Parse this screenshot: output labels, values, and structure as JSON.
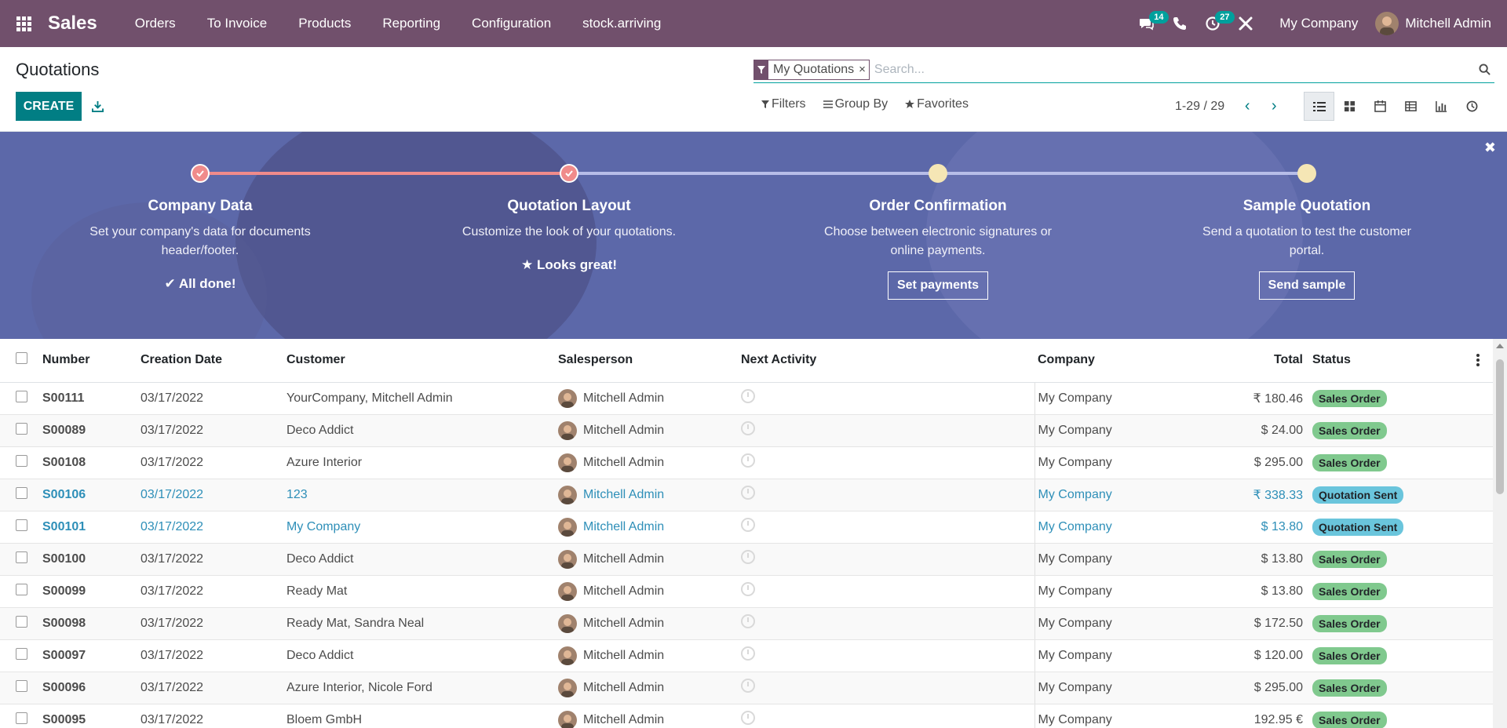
{
  "navbar": {
    "app_name": "Sales",
    "menu": [
      "Orders",
      "To Invoice",
      "Products",
      "Reporting",
      "Configuration",
      "stock.arriving"
    ],
    "messages_count": "14",
    "activities_count": "27",
    "company": "My Company",
    "user": "Mitchell Admin"
  },
  "control_panel": {
    "title": "Quotations",
    "create_label": "CREATE",
    "facet_label": "My Quotations",
    "facet_close": "×",
    "search_placeholder": "Search...",
    "filters_label": "Filters",
    "groupby_label": "Group By",
    "favorites_label": "Favorites",
    "pager": "1-29 / 29"
  },
  "banner": {
    "steps": [
      {
        "title": "Company Data",
        "desc": "Set your company's data for documents header/footer.",
        "status": "All done!"
      },
      {
        "title": "Quotation Layout",
        "desc": "Customize the look of your quotations.",
        "status": "Looks great!"
      },
      {
        "title": "Order Confirmation",
        "desc": "Choose between electronic signatures or online payments.",
        "button": "Set payments"
      },
      {
        "title": "Sample Quotation",
        "desc": "Send a quotation to test the customer portal.",
        "button": "Send sample"
      }
    ]
  },
  "table": {
    "headers": {
      "number": "Number",
      "date": "Creation Date",
      "customer": "Customer",
      "salesperson": "Salesperson",
      "activity": "Next Activity",
      "company": "Company",
      "total": "Total",
      "status": "Status"
    },
    "rows": [
      {
        "number": "S00111",
        "date": "03/17/2022",
        "customer": "YourCompany, Mitchell Admin",
        "salesperson": "Mitchell Admin",
        "company": "My Company",
        "total": "₹ 180.46",
        "status": "Sales Order"
      },
      {
        "number": "S00089",
        "date": "03/17/2022",
        "customer": "Deco Addict",
        "salesperson": "Mitchell Admin",
        "company": "My Company",
        "total": "$ 24.00",
        "status": "Sales Order"
      },
      {
        "number": "S00108",
        "date": "03/17/2022",
        "customer": "Azure Interior",
        "salesperson": "Mitchell Admin",
        "company": "My Company",
        "total": "$ 295.00",
        "status": "Sales Order"
      },
      {
        "number": "S00106",
        "date": "03/17/2022",
        "customer": "123",
        "salesperson": "Mitchell Admin",
        "company": "My Company",
        "total": "₹ 338.33",
        "status": "Quotation Sent"
      },
      {
        "number": "S00101",
        "date": "03/17/2022",
        "customer": "My Company",
        "salesperson": "Mitchell Admin",
        "company": "My Company",
        "total": "$ 13.80",
        "status": "Quotation Sent"
      },
      {
        "number": "S00100",
        "date": "03/17/2022",
        "customer": "Deco Addict",
        "salesperson": "Mitchell Admin",
        "company": "My Company",
        "total": "$ 13.80",
        "status": "Sales Order"
      },
      {
        "number": "S00099",
        "date": "03/17/2022",
        "customer": "Ready Mat",
        "salesperson": "Mitchell Admin",
        "company": "My Company",
        "total": "$ 13.80",
        "status": "Sales Order"
      },
      {
        "number": "S00098",
        "date": "03/17/2022",
        "customer": "Ready Mat, Sandra Neal",
        "salesperson": "Mitchell Admin",
        "company": "My Company",
        "total": "$ 172.50",
        "status": "Sales Order"
      },
      {
        "number": "S00097",
        "date": "03/17/2022",
        "customer": "Deco Addict",
        "salesperson": "Mitchell Admin",
        "company": "My Company",
        "total": "$ 120.00",
        "status": "Sales Order"
      },
      {
        "number": "S00096",
        "date": "03/17/2022",
        "customer": "Azure Interior, Nicole Ford",
        "salesperson": "Mitchell Admin",
        "company": "My Company",
        "total": "$ 295.00",
        "status": "Sales Order"
      },
      {
        "number": "S00095",
        "date": "03/17/2022",
        "customer": "Bloem GmbH",
        "salesperson": "Mitchell Admin",
        "company": "My Company",
        "total": "192.95 €",
        "status": "Sales Order"
      }
    ]
  },
  "colors": {
    "navbar": "#71506c",
    "primary": "#017e84",
    "banner": "#5c68a9",
    "sales_order": "#80c98e",
    "quotation_sent": "#6ac5dc",
    "link": "#2e8fb8"
  }
}
